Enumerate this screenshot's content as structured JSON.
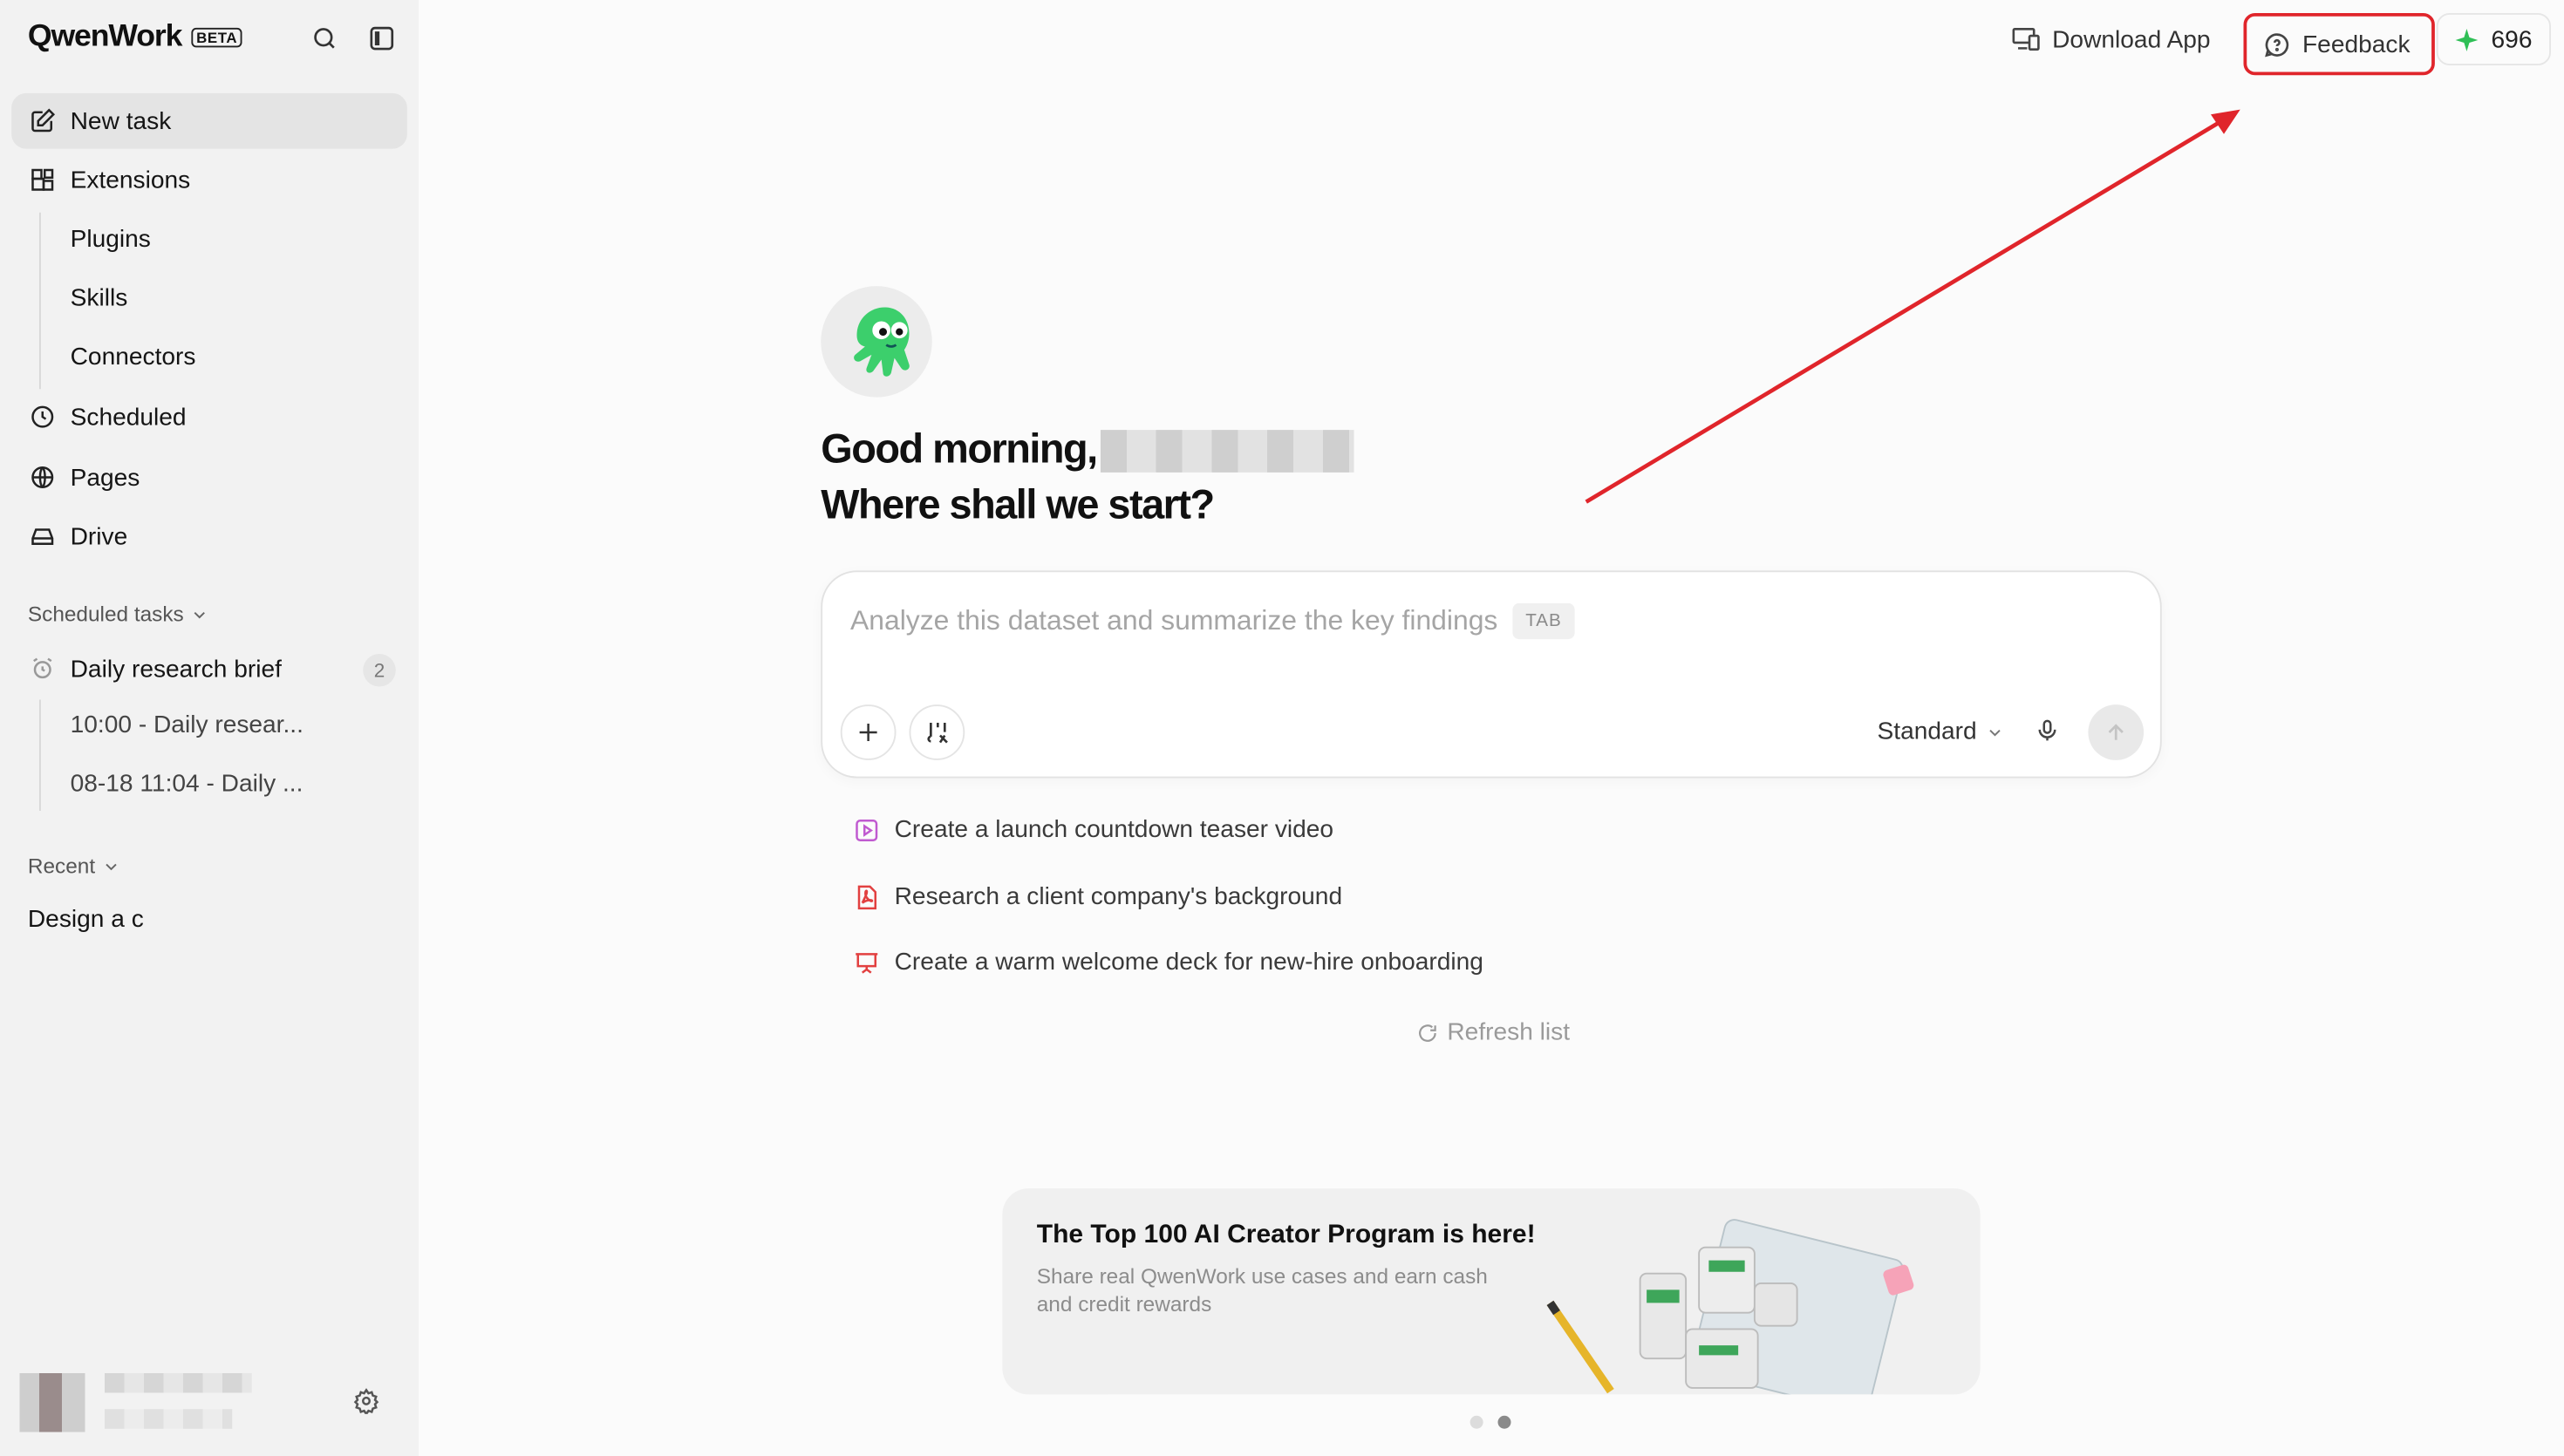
{
  "app": {
    "name": "QwenWork",
    "badge": "BETA"
  },
  "sidebar": {
    "new_task": "New task",
    "extensions": "Extensions",
    "extension_items": [
      "Plugins",
      "Skills",
      "Connectors"
    ],
    "scheduled": "Scheduled",
    "pages": "Pages",
    "drive": "Drive",
    "scheduled_tasks_label": "Scheduled tasks",
    "scheduled_task": {
      "title": "Daily research brief",
      "count": "2",
      "runs": [
        "10:00 - Daily resear...",
        "08-18 11:04 - Daily ..."
      ]
    },
    "recent_label": "Recent",
    "recent_items": [
      "Design a c"
    ]
  },
  "topbar": {
    "download_app": "Download App",
    "feedback": "Feedback",
    "credits": "696",
    "colors": {
      "annotation": "#e0252b",
      "credit_star": "#2fbf56"
    }
  },
  "hero": {
    "greeting": "Good morning,",
    "subtitle": "Where shall we start?"
  },
  "composer": {
    "placeholder": "Analyze this dataset and summarize the key findings",
    "tab_hint": "TAB",
    "mode": "Standard"
  },
  "suggestions": [
    {
      "text": "Create a launch countdown teaser video",
      "icon": "video-icon",
      "color": "#c05ad0"
    },
    {
      "text": "Research a client company's background",
      "icon": "pdf-icon",
      "color": "#e24040"
    },
    {
      "text": "Create a warm welcome deck for new-hire onboarding",
      "icon": "presentation-icon",
      "color": "#e24040"
    }
  ],
  "refresh_label": "Refresh list",
  "banner": {
    "title": "The Top 100 AI Creator Program is here!",
    "text": "Share real QwenWork use cases and earn cash and credit rewards",
    "active_slide": 2,
    "slide_count": 2
  }
}
